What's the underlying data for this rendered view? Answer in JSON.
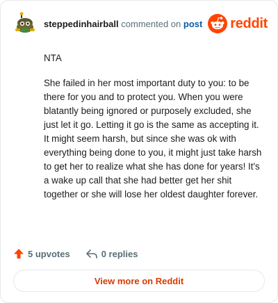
{
  "comment": {
    "author": "steppedinhairball",
    "action_text": "commented on",
    "post_link_label": "post",
    "paragraphs": [
      "NTA",
      "She failed in her most important duty to you: to be there for you and to protect you. When you were blatantly being ignored or purposely excluded, she just let it go. Letting it go is the same as accepting it. It might seem harsh, but since she was ok with everything being done to you, it might just take harsh to get her to realize what she has done for years! It's a wake up call that she had better get her shit together or she will lose her oldest daughter forever."
    ]
  },
  "brand": {
    "wordmark": "reddit",
    "icon": "reddit-snoo-icon",
    "color": "#ff4500"
  },
  "stats": {
    "upvotes_label": "5 upvotes",
    "replies_label": "0 replies"
  },
  "footer": {
    "view_more_label": "View more on Reddit"
  },
  "colors": {
    "upvote": "#ff4500",
    "link": "#0b5ba8",
    "view_more": "#d93a00"
  }
}
